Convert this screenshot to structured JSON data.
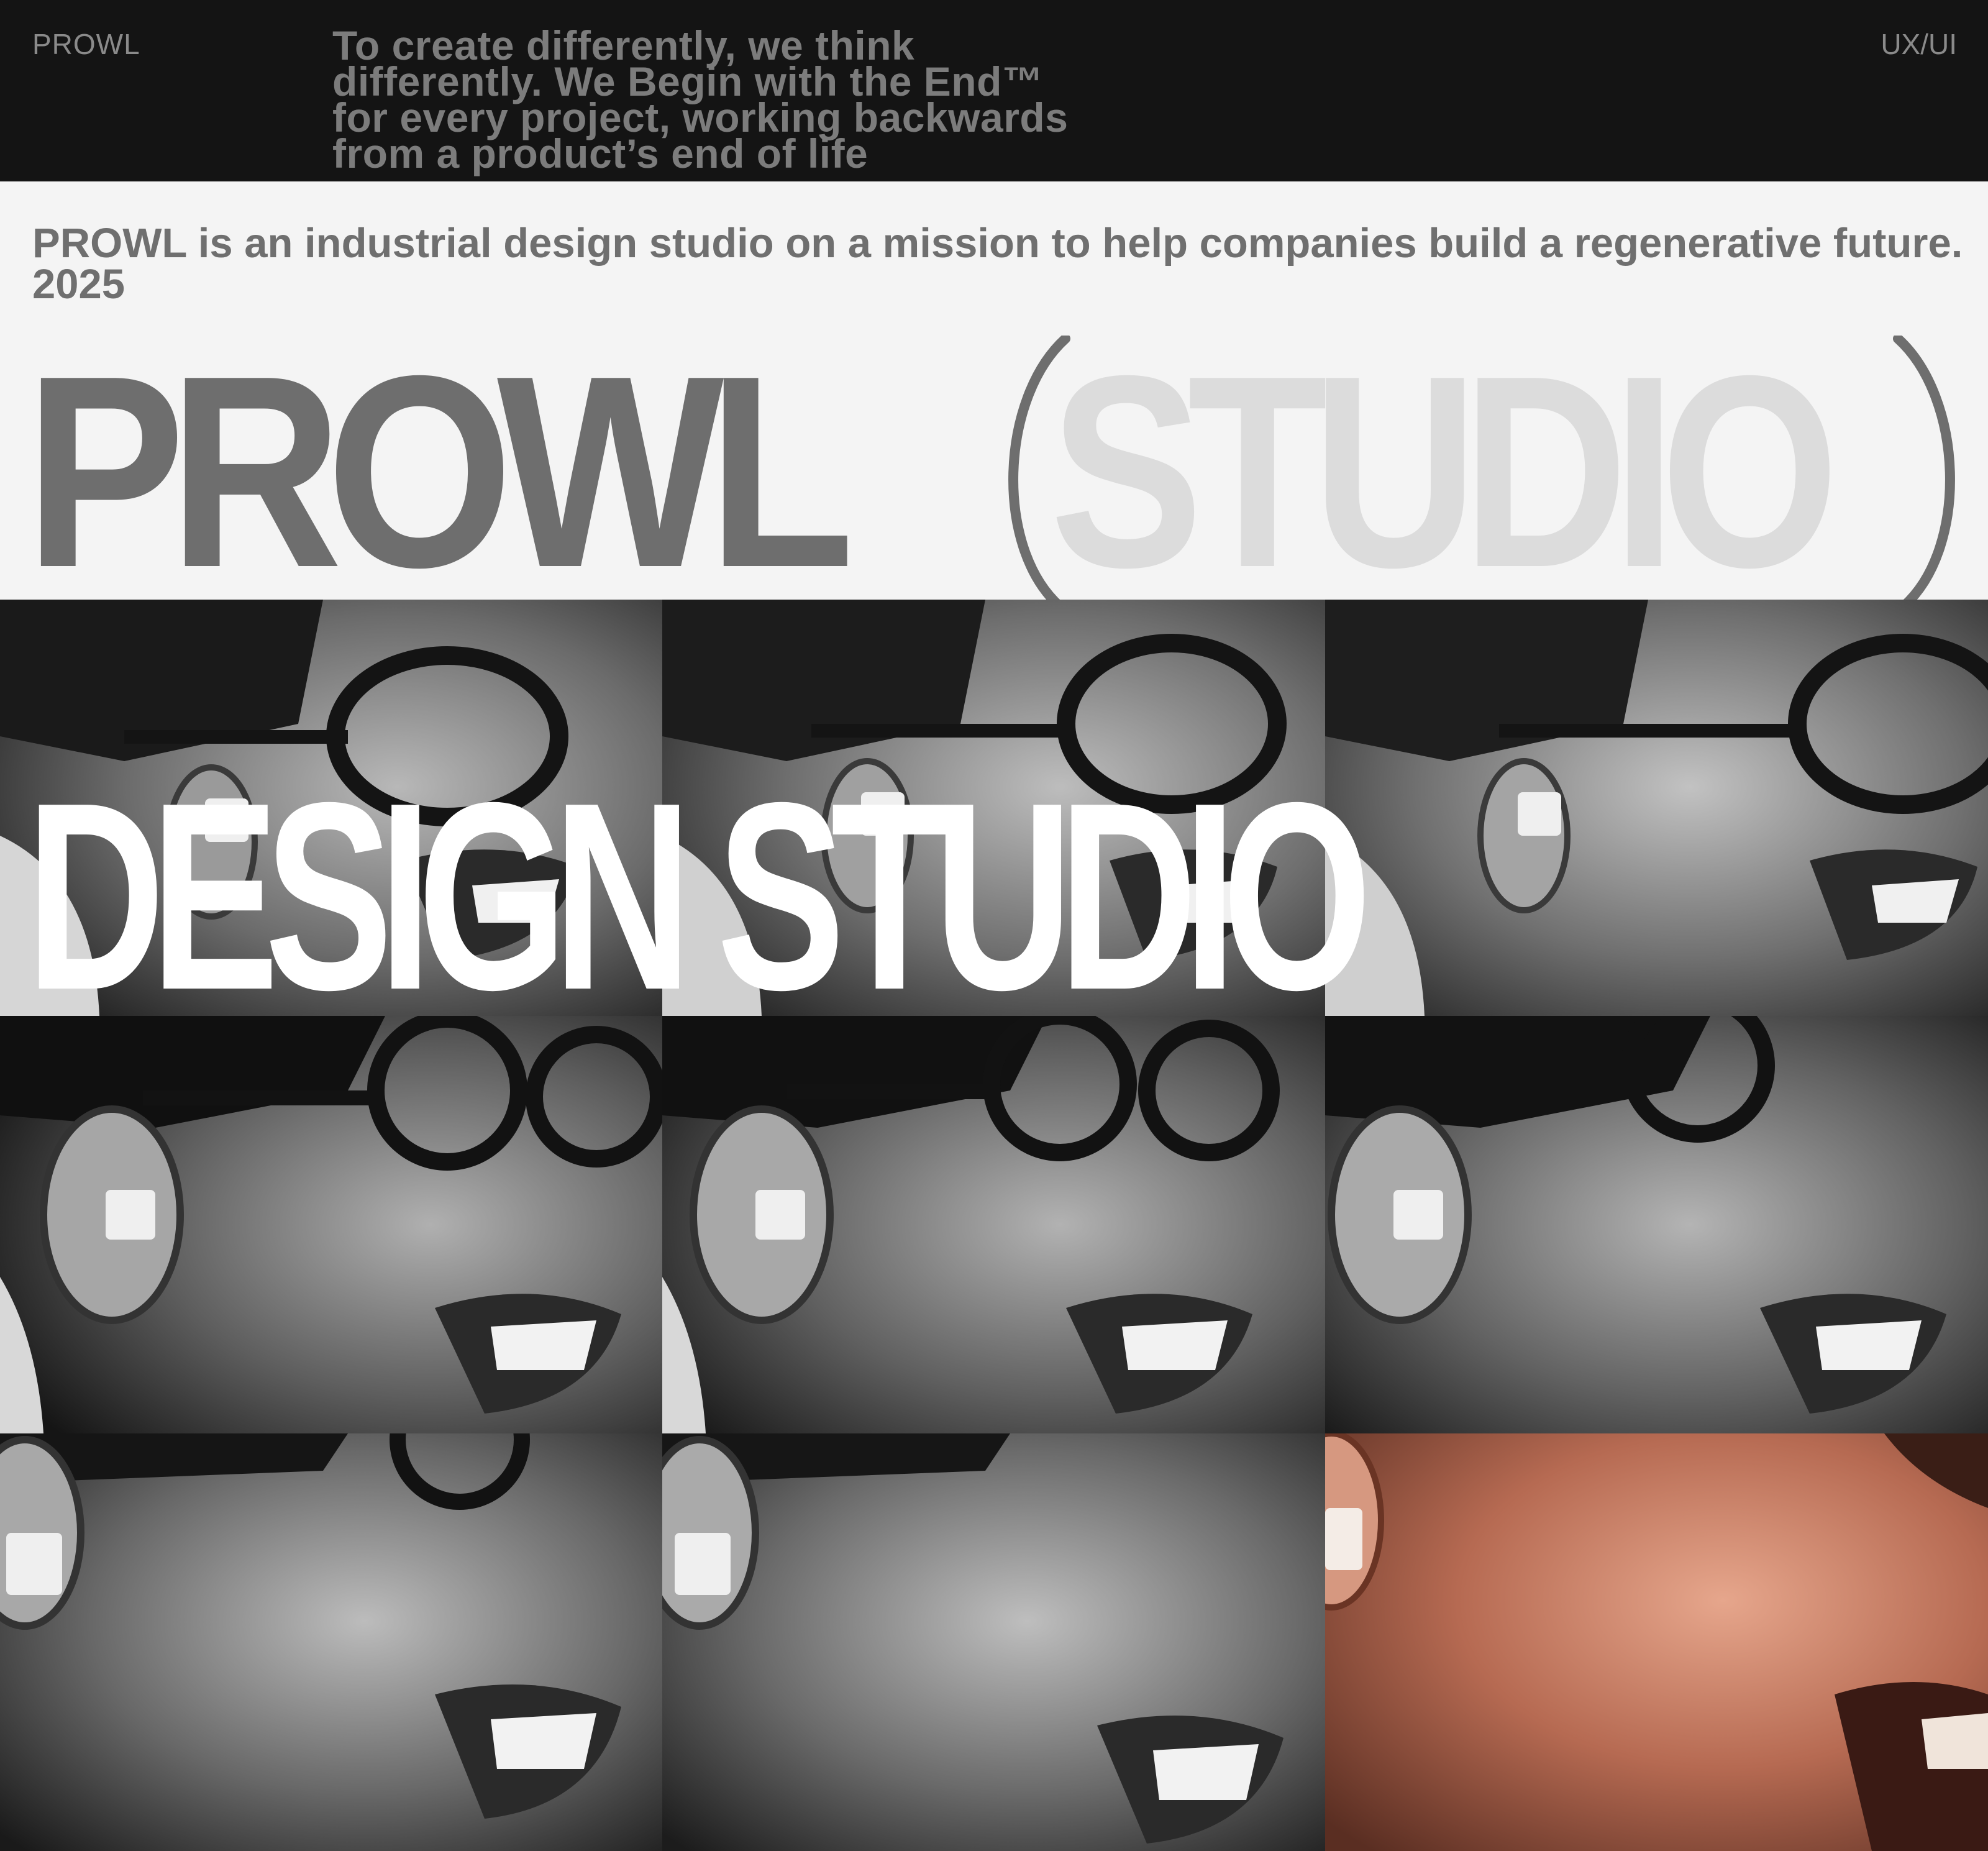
{
  "header": {
    "brand": "PROWL",
    "tagline_lines": [
      "To create differently, we think",
      "differently. We Begin with the End™",
      "for every project, working backwards",
      "from a product’s end of life"
    ],
    "discipline": "UX/UI"
  },
  "intro": {
    "text": "PROWL is an industrial design studio on a mission to help companies build a regenerative future. 2025"
  },
  "wordmark": {
    "primary": "PROWL",
    "secondary": "STUDIO"
  },
  "hero": {
    "title": "DESIGN STUDIO"
  },
  "gallery": {
    "tiles": [
      {
        "tone": "grayscale"
      },
      {
        "tone": "grayscale"
      },
      {
        "tone": "grayscale"
      },
      {
        "tone": "grayscale"
      },
      {
        "tone": "grayscale"
      },
      {
        "tone": "grayscale"
      },
      {
        "tone": "grayscale"
      },
      {
        "tone": "grayscale"
      },
      {
        "tone": "color"
      }
    ]
  },
  "colors": {
    "topbar_bg": "#141414",
    "page_bg": "#f4f4f4",
    "wordmark_primary": "#6e6e6e",
    "wordmark_secondary": "#dcdcdc",
    "hero_title": "#ffffff"
  }
}
